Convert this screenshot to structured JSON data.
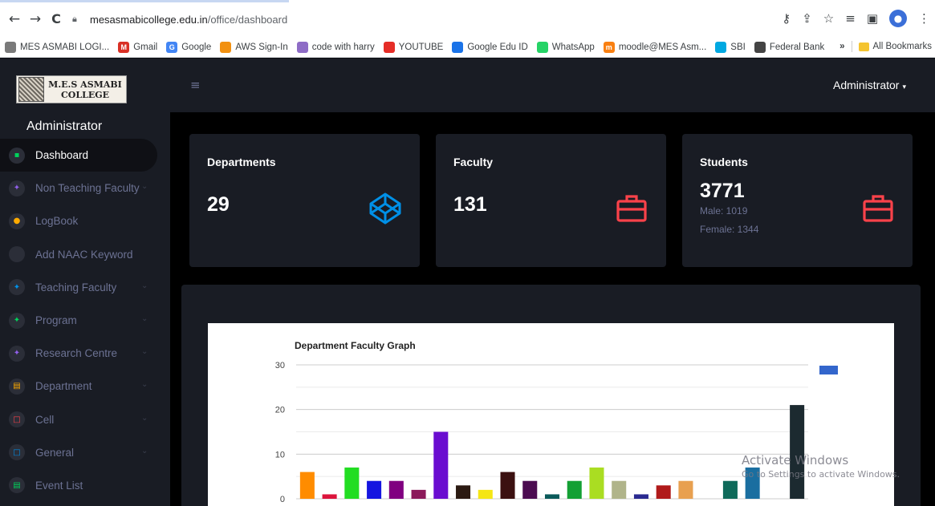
{
  "browser": {
    "url_domain": "mesasmabicollege.edu.in",
    "url_path": "/office/dashboard",
    "nav": {
      "back": "←",
      "forward": "→",
      "reload": "C"
    },
    "bookmarks": [
      {
        "label": "MES ASMABI LOGI...",
        "color": "#7a7a7a"
      },
      {
        "label": "Gmail",
        "color": "#d93025",
        "glyph": "M"
      },
      {
        "label": "Google",
        "color": "#4285f4",
        "glyph": "G"
      },
      {
        "label": "AWS Sign-In",
        "color": "#f29111"
      },
      {
        "label": "code with harry",
        "color": "#8e6cc6"
      },
      {
        "label": "YOUTUBE",
        "color": "#e52d27"
      },
      {
        "label": "Google Edu ID",
        "color": "#1a73e8"
      },
      {
        "label": "WhatsApp",
        "color": "#25d366"
      },
      {
        "label": "moodle@MES Asm...",
        "color": "#f98012",
        "glyph": "m"
      },
      {
        "label": "SBI",
        "color": "#00a8e1"
      },
      {
        "label": "Federal Bank",
        "color": "#444444"
      }
    ],
    "bookmarks_overflow": "»",
    "all_bookmarks": "All Bookmarks"
  },
  "logo": {
    "line1": "M.E.S ASMABI",
    "line2": "COLLEGE"
  },
  "sidebar": {
    "title": "Administrator",
    "items": [
      {
        "label": "Dashboard",
        "icon": "dashboard-icon",
        "color": "#00d25b",
        "glyph": "▪",
        "active": true,
        "chevron": false
      },
      {
        "label": "Non Teaching Faculty",
        "icon": "faculty-icon",
        "color": "#8f5fe8",
        "glyph": "✦",
        "chevron": true
      },
      {
        "label": "LogBook",
        "icon": "logbook-icon",
        "color": "#ffab00",
        "glyph": "●",
        "chevron": false
      },
      {
        "label": "Add NAAC Keyword",
        "icon": "keyword-icon",
        "color": "#2b2e38",
        "glyph": "",
        "chevron": false
      },
      {
        "label": "Teaching Faculty",
        "icon": "teaching-icon",
        "color": "#0090e7",
        "glyph": "✦",
        "chevron": true
      },
      {
        "label": "Program",
        "icon": "program-icon",
        "color": "#00d25b",
        "glyph": "✦",
        "chevron": true
      },
      {
        "label": "Research Centre",
        "icon": "research-icon",
        "color": "#8f5fe8",
        "glyph": "✦",
        "chevron": true
      },
      {
        "label": "Department",
        "icon": "department-icon",
        "color": "#ffab00",
        "glyph": "▤",
        "chevron": true
      },
      {
        "label": "Cell",
        "icon": "cell-icon",
        "color": "#fc424a",
        "glyph": "□",
        "chevron": true
      },
      {
        "label": "General",
        "icon": "general-icon",
        "color": "#0090e7",
        "glyph": "□",
        "chevron": true
      },
      {
        "label": "Event List",
        "icon": "event-icon",
        "color": "#00d25b",
        "glyph": "▤",
        "chevron": false
      }
    ]
  },
  "header": {
    "menu_glyph": "≡",
    "user": "Administrator",
    "caret": "▾"
  },
  "cards": {
    "departments": {
      "title": "Departments",
      "value": "29",
      "icon": "codepen-icon",
      "icon_color": "#0090e7"
    },
    "faculty": {
      "title": "Faculty",
      "value": "131",
      "icon": "briefcase-icon",
      "icon_color": "#fc424a"
    },
    "students": {
      "title": "Students",
      "value": "3771",
      "male": "Male: 1019",
      "female": "Female: 1344",
      "icon": "briefcase-icon",
      "icon_color": "#fc424a"
    }
  },
  "chart_data": {
    "type": "bar",
    "title": "Department Faculty Graph",
    "xlabel": "",
    "ylabel": "",
    "ylim": [
      0,
      30
    ],
    "yticks": [
      0,
      10,
      20,
      30
    ],
    "grid": true,
    "values": [
      6,
      1,
      7,
      4,
      4,
      2,
      15,
      3,
      2,
      6,
      4,
      1,
      4,
      7,
      4,
      1,
      3,
      4,
      0,
      4,
      7,
      0,
      21
    ],
    "colors": [
      "#ff8c00",
      "#dc143c",
      "#22dd22",
      "#1515e0",
      "#800080",
      "#8b1a5a",
      "#6a0dd0",
      "#2b1a12",
      "#f5e614",
      "#3b1010",
      "#4b0b50",
      "#0a5a5a",
      "#14a034",
      "#aadd22",
      "#b0b48a",
      "#2a2a90",
      "#b01a1a",
      "#e8a050",
      "#ffffff",
      "#0f6a5a",
      "#1a6ea0",
      "#ffffff",
      "#1c2a30"
    ],
    "legend_color": "#3366cc",
    "legend_position": "top-right"
  },
  "watermark": {
    "line1": "Activate Windows",
    "line2": "Go to Settings to activate Windows."
  }
}
